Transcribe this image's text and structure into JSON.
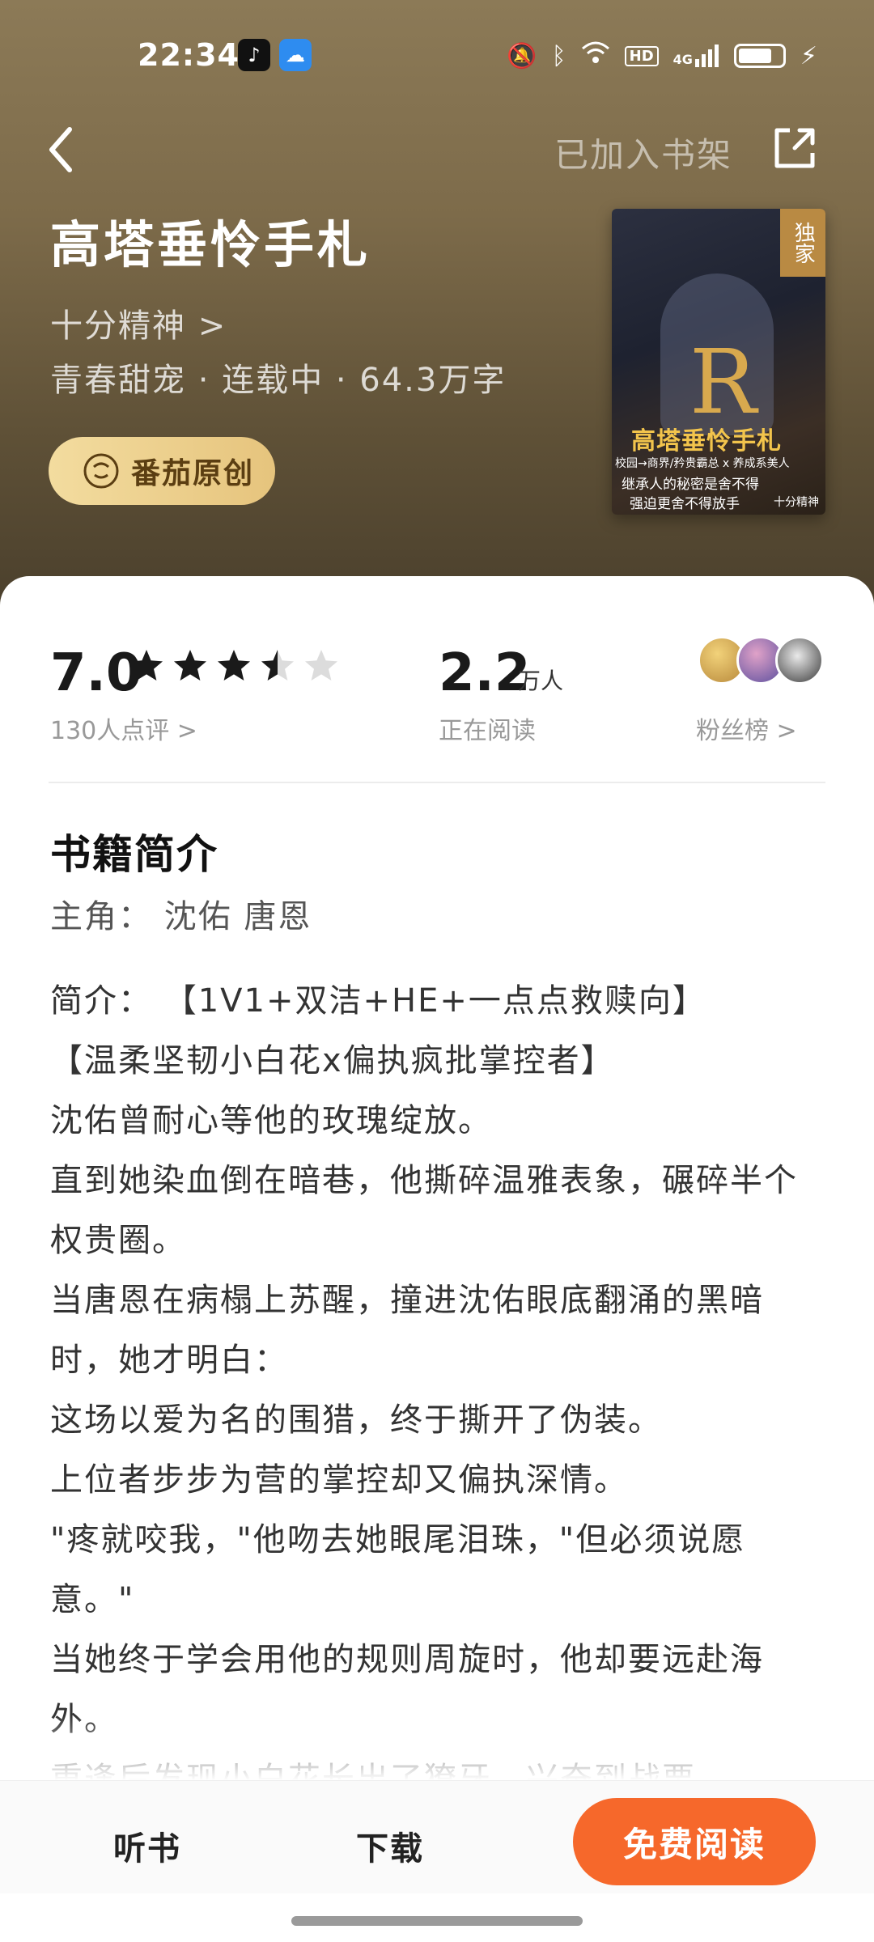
{
  "status_bar": {
    "time": "22:34",
    "hd": "HD",
    "network": "4G",
    "icons": [
      "tiktok-icon",
      "weather-icon",
      "mute-icon",
      "bluetooth-icon",
      "wifi-icon",
      "signal-icon",
      "battery-icon",
      "charging-icon"
    ],
    "battery_level": 0.7
  },
  "nav": {
    "back_icon": "chevron-left-icon",
    "shelf_status": "已加入书架",
    "share_icon": "share-icon"
  },
  "book": {
    "title": "高塔垂怜手札",
    "author": "十分精神 >",
    "meta": "青春甜宠 · 连载中 · 64.3万字",
    "badge_label": "番茄原创",
    "cover": {
      "exclusive": "独家",
      "letter": "R",
      "title": "高塔垂怜手札",
      "tagline1": "校园→商界/矜贵霸总 x 养成系美人",
      "tagline2": "继承人的秘密是舍不得",
      "tagline3": "强迫更舍不得放手",
      "author": "十分精神"
    }
  },
  "stats": {
    "score": "7.0",
    "star_rating": 3.5,
    "star_count": 5,
    "rating_count": "130人点评 >",
    "readers": "2.2",
    "readers_unit": "万人",
    "readers_label": "正在阅读",
    "fans_label": "粉丝榜 >"
  },
  "intro": {
    "heading": "书籍简介",
    "leads": "主角： 沈佑 唐恩",
    "lines": [
      "简介： 【1V1+双洁+HE+一点点救赎向】",
      "【温柔坚韧小白花x偏执疯批掌控者】",
      "沈佑曾耐心等他的玫瑰绽放。",
      "直到她染血倒在暗巷，他撕碎温雅表象，碾碎半个权贵圈。",
      "当唐恩在病榻上苏醒，撞进沈佑眼底翻涌的黑暗时，她才明白：",
      "这场以爱为名的围猎，终于撕开了伪装。",
      "上位者步步为营的掌控却又偏执深情。",
      "\"疼就咬我，\"他吻去她眼尾泪珠，\"但必须说愿意。\"",
      "当她终于学会用他的规则周旋时，他却要远赴海外。",
      "重逢后发现小白花长出了獠牙，兴奋到战栗"
    ]
  },
  "bottom": {
    "listen": "听书",
    "download": "下载",
    "read": "免费阅读"
  },
  "colors": {
    "accent": "#f6682b",
    "header_bg": "#7d6b4a",
    "badge_gold": "#e6c47d"
  }
}
